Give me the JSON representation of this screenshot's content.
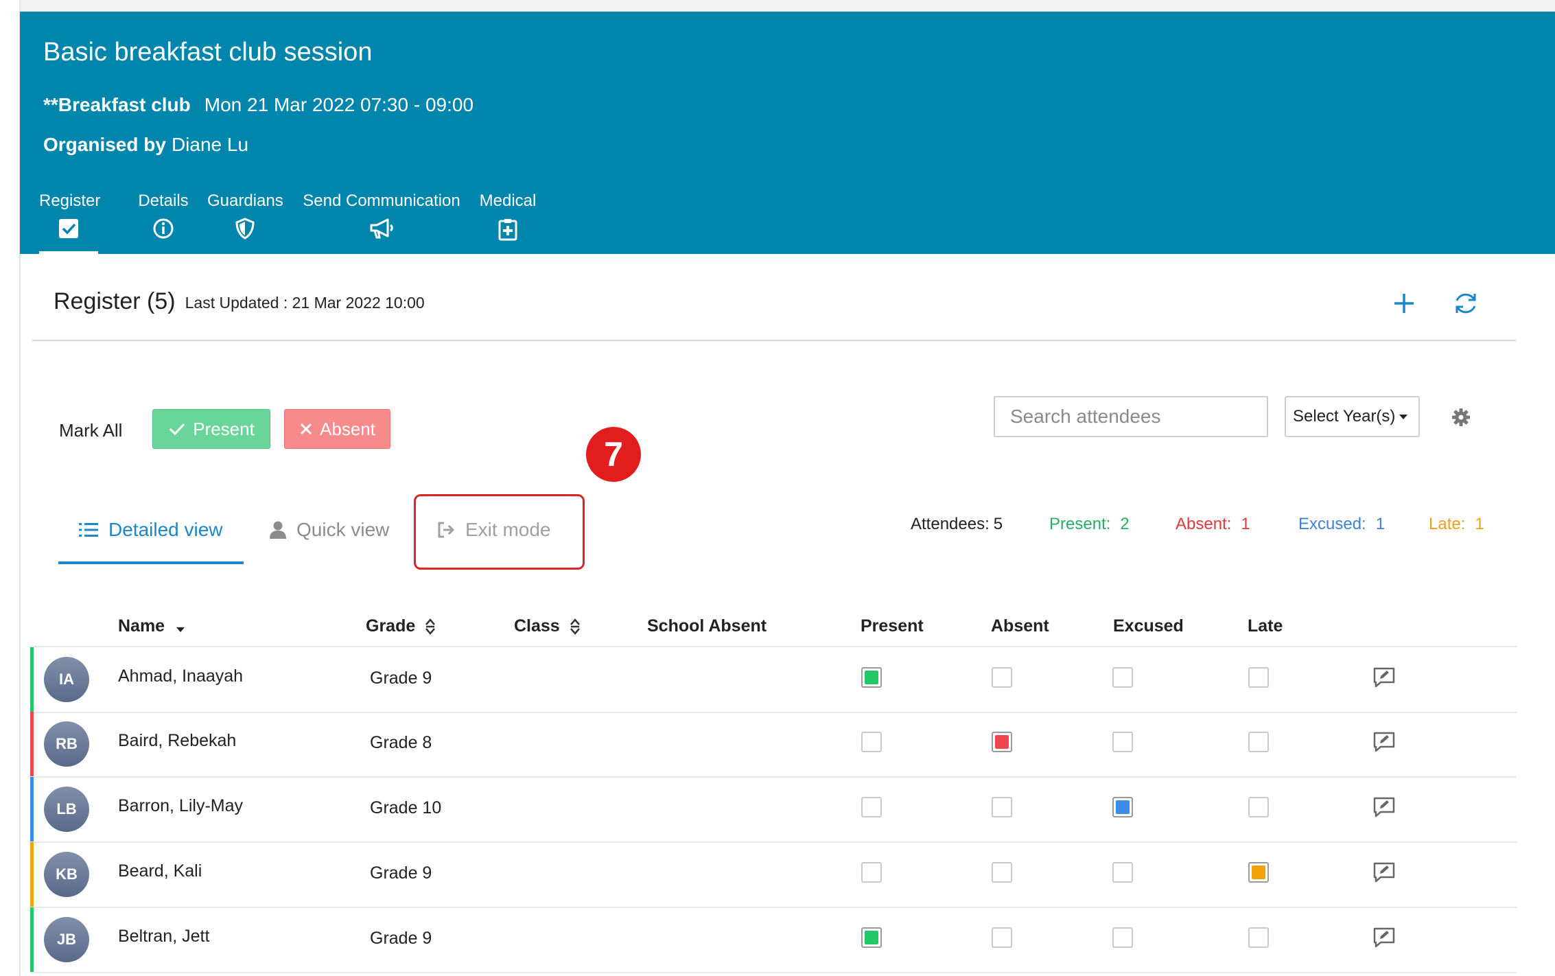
{
  "header": {
    "title": "Basic breakfast club session",
    "club_name": "**Breakfast club",
    "datetime": "Mon 21 Mar 2022 07:30 - 09:00",
    "organised_label": "Organised by",
    "organiser": "Diane Lu",
    "tabs": [
      {
        "label": "Register",
        "icon": "checkbox-icon",
        "active": true
      },
      {
        "label": "Details",
        "icon": "info-icon"
      },
      {
        "label": "Guardians",
        "icon": "shield-icon"
      },
      {
        "label": "Send Communication",
        "icon": "megaphone-icon"
      },
      {
        "label": "Medical",
        "icon": "medical-clipboard-icon"
      }
    ]
  },
  "register": {
    "title": "Register (5)",
    "last_updated": "Last Updated : 21 Mar 2022 10:00",
    "add_icon": "plus-icon",
    "refresh_icon": "refresh-icon"
  },
  "toolbar": {
    "mark_all": "Mark All",
    "present_btn": "Present",
    "absent_btn": "Absent",
    "search_placeholder": "Search attendees",
    "select_years": "Select Year(s)",
    "settings_icon": "gear-icon"
  },
  "annotation": {
    "step_number": "7"
  },
  "views": {
    "detailed": "Detailed view",
    "quick": "Quick view",
    "exit": "Exit mode"
  },
  "stats": {
    "attendees_label": "Attendees:",
    "attendees": "5",
    "present_label": "Present:",
    "present": "2",
    "absent_label": "Absent:",
    "absent": "1",
    "excused_label": "Excused:",
    "excused": "1",
    "late_label": "Late:",
    "late": "1"
  },
  "colors": {
    "header_bg": "#0086ad",
    "present": "#22c766",
    "absent": "#f0474f",
    "excused": "#3d8be8",
    "late": "#f0a30a",
    "stat_present": "#27ae60",
    "stat_absent": "#e2393e",
    "stat_excused": "#3d82d6",
    "stat_late": "#f0a020"
  },
  "table": {
    "columns": {
      "name": "Name",
      "grade": "Grade",
      "class": "Class",
      "school_absent": "School Absent",
      "present": "Present",
      "absent": "Absent",
      "excused": "Excused",
      "late": "Late"
    },
    "rows": [
      {
        "initials": "IA",
        "name": "Ahmad, Inaayah",
        "grade": "Grade 9",
        "status": "present"
      },
      {
        "initials": "RB",
        "name": "Baird, Rebekah",
        "grade": "Grade 8",
        "status": "absent"
      },
      {
        "initials": "LB",
        "name": "Barron, Lily-May",
        "grade": "Grade 10",
        "status": "excused"
      },
      {
        "initials": "KB",
        "name": "Beard, Kali",
        "grade": "Grade 9",
        "status": "late"
      },
      {
        "initials": "JB",
        "name": "Beltran, Jett",
        "grade": "Grade 9",
        "status": "present"
      }
    ]
  }
}
